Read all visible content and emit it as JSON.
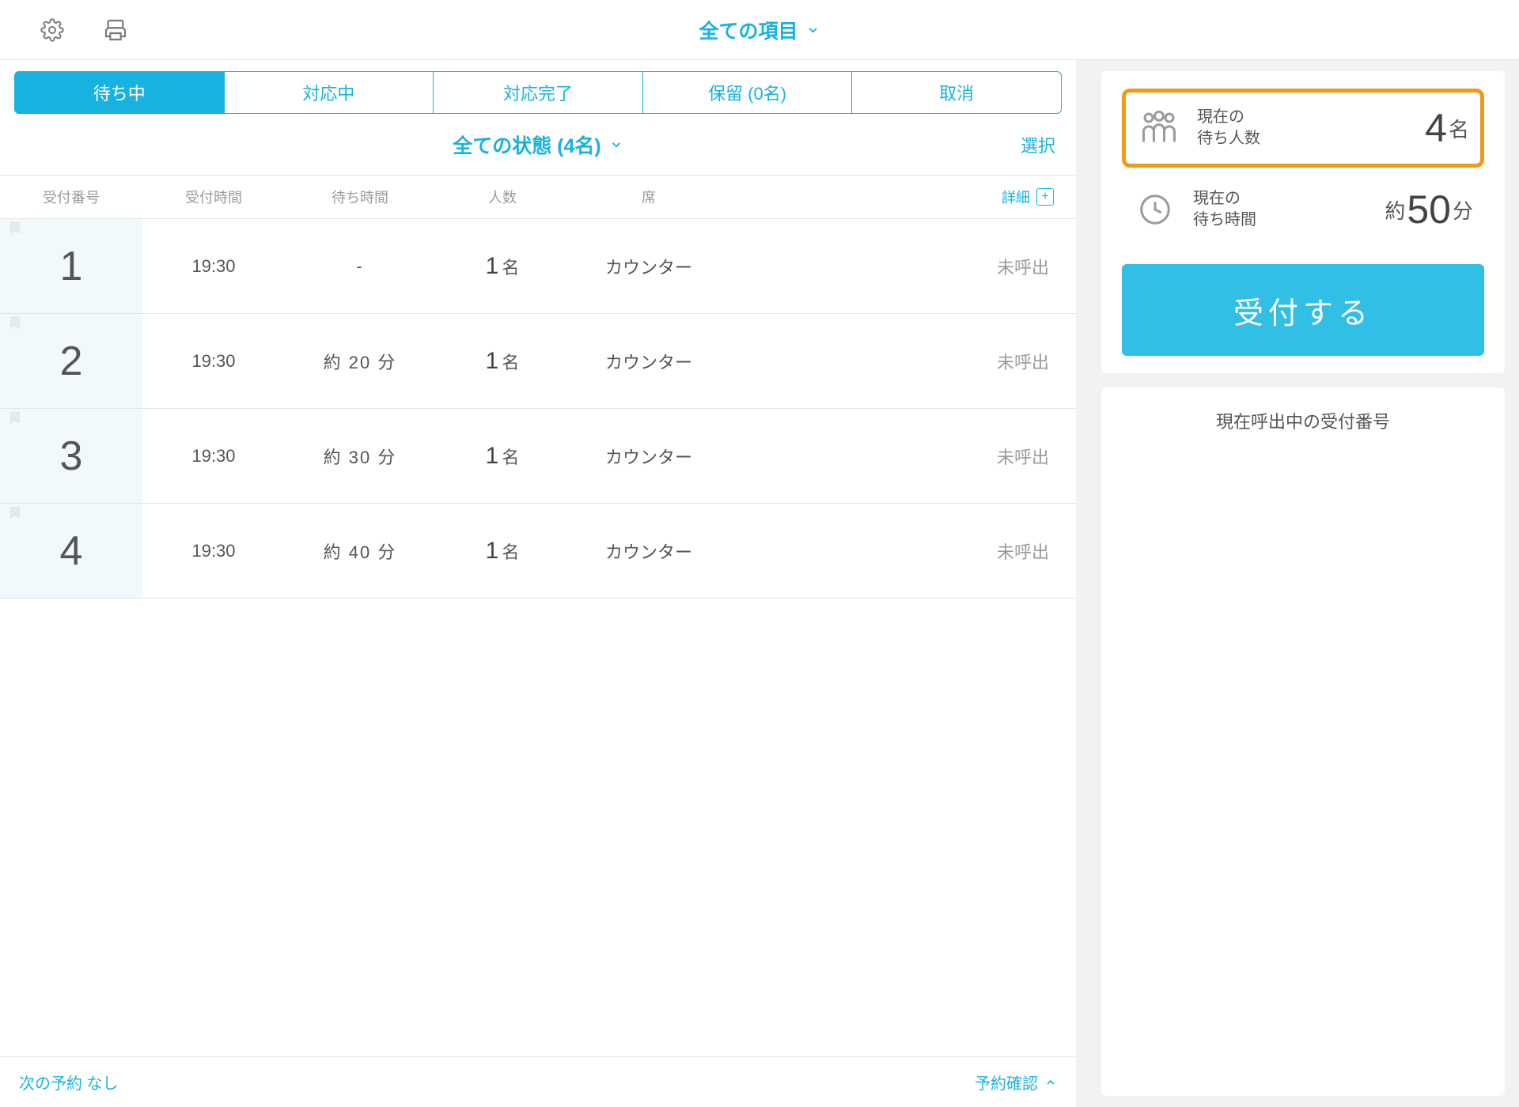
{
  "header": {
    "dropdown_label": "全ての項目"
  },
  "tabs": {
    "waiting": "待ち中",
    "serving": "対応中",
    "done": "対応完了",
    "hold": "保留 (0名)",
    "cancel": "取消"
  },
  "subheader": {
    "label": "全ての状態 (4名)",
    "select": "選択"
  },
  "columns": {
    "num": "受付番号",
    "time": "受付時間",
    "wait": "待ち時間",
    "ppl": "人数",
    "seat": "席",
    "detail": "詳細"
  },
  "rows": [
    {
      "num": "1",
      "time": "19:30",
      "wait": "-",
      "ppl": "1",
      "ppl_suf": "名",
      "seat": "カウンター",
      "status": "未呼出"
    },
    {
      "num": "2",
      "time": "19:30",
      "wait": "約 20 分",
      "ppl": "1",
      "ppl_suf": "名",
      "seat": "カウンター",
      "status": "未呼出"
    },
    {
      "num": "3",
      "time": "19:30",
      "wait": "約 30 分",
      "ppl": "1",
      "ppl_suf": "名",
      "seat": "カウンター",
      "status": "未呼出"
    },
    {
      "num": "4",
      "time": "19:30",
      "wait": "約 40 分",
      "ppl": "1",
      "ppl_suf": "名",
      "seat": "カウンター",
      "status": "未呼出"
    }
  ],
  "footer": {
    "next": "次の予約 なし",
    "confirm": "予約確認"
  },
  "side": {
    "wait_people_l1": "現在の",
    "wait_people_l2": "待ち人数",
    "wait_people_n": "4",
    "wait_people_suf": "名",
    "wait_time_l1": "現在の",
    "wait_time_l2": "待ち時間",
    "wait_time_pre": "約",
    "wait_time_n": "50",
    "wait_time_suf": "分",
    "accept_btn": "受付する",
    "calling_title": "現在呼出中の受付番号"
  }
}
